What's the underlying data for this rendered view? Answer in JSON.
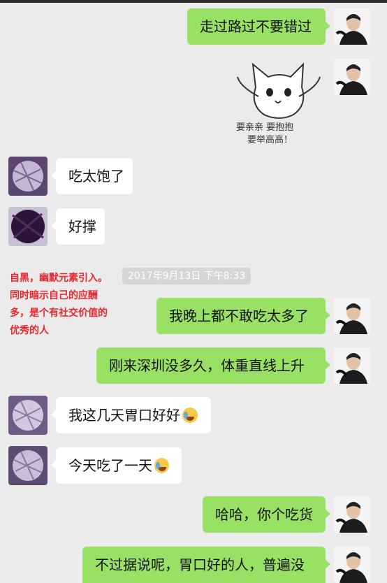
{
  "messages": [
    {
      "side": "me",
      "text": "走过路过不要错过"
    },
    {
      "side": "me",
      "sticker_line1": "要亲亲  要抱抱",
      "sticker_line2": "要举高高！"
    },
    {
      "side": "other",
      "text": "吃太饱了"
    },
    {
      "side": "other",
      "text": "好撑"
    },
    {
      "side": "me",
      "text": "我晚上都不敢吃太多了"
    },
    {
      "side": "me",
      "text": "刚来深圳没多久，体重直线上升"
    },
    {
      "side": "other",
      "text": "我这几天胃口好好",
      "emoji": "crying-laughing-emoji"
    },
    {
      "side": "other",
      "text": "今天吃了一天",
      "emoji": "crying-laughing-emoji"
    },
    {
      "side": "me",
      "text": "哈哈，你个吃货"
    },
    {
      "side": "me",
      "text": "不过据说呢，胃口好的人，普遍没"
    }
  ],
  "timestamp": "2017年9月13日 下午8:33",
  "annotation": {
    "line1": "自黑，幽默元素引入。",
    "line2": "同时暗示自己的应酬",
    "line3": "多，是个有社交价值的",
    "line4": "优秀的人"
  },
  "colors": {
    "background": "#ebebeb",
    "my_bubble": "#98e165",
    "other_bubble": "#ffffff",
    "annotation_text": "#e8262d"
  }
}
